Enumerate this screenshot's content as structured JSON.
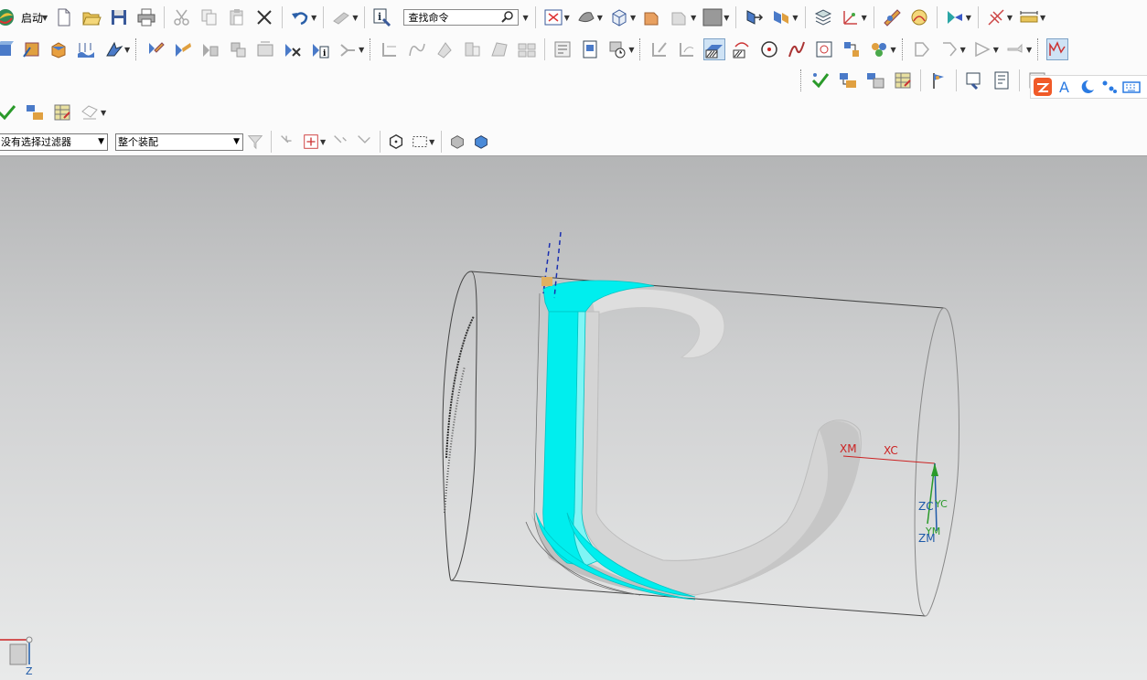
{
  "toolbar": {
    "start_label": "启动",
    "search_placeholder": "查找命令"
  },
  "selection_bar": {
    "filter_value": "没有选择过滤器",
    "scope_value": "整个装配"
  },
  "viewport": {
    "wcs_labels": {
      "xc": "XC",
      "yc": "YC",
      "zc": "ZC"
    },
    "abs_labels": {
      "xm": "XM",
      "ym": "YM",
      "zm": "ZM"
    },
    "triad_z": "Z"
  },
  "icons": [
    "nx-logo-icon",
    "new-file-icon",
    "open-folder-icon",
    "save-icon",
    "print-icon",
    "cut-icon",
    "copy-icon",
    "paste-icon",
    "delete-icon",
    "undo-icon",
    "repeat-command-icon",
    "information-icon",
    "search-icon",
    "fit-view-icon",
    "shaded-view-icon",
    "cube-view-icon",
    "show-hide-icon",
    "background-icon",
    "layer-icon",
    "wcs-icon",
    "measure-icon",
    "ime-logo-icon",
    "ime-text-icon",
    "ime-moon-icon",
    "ime-dots-icon",
    "ime-keyboard-icon"
  ],
  "colors": {
    "accent_cyan": "#00eeee",
    "xc_axis": "#cc2222",
    "zc_axis": "#1e5aa8",
    "yc_axis": "#2a9a2a",
    "ime_orange": "#f05a28",
    "ime_blue": "#2a7ae2"
  }
}
